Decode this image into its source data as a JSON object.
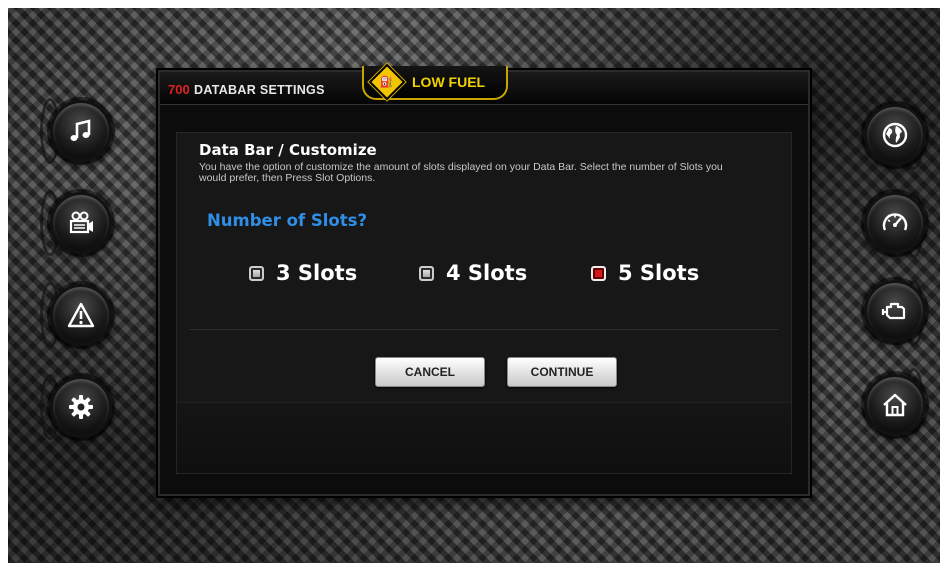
{
  "header": {
    "page_number": "700",
    "title": "DATABAR SETTINGS",
    "alert": {
      "icon": "fuel-pump-icon",
      "text": "LOW FUEL"
    }
  },
  "section": {
    "title": "Data Bar / Customize",
    "description": "You have the option of customize the amount of slots displayed on your Data Bar. Select the number of Slots you would prefer, then Press Slot Options."
  },
  "question": "Number of Slots?",
  "options": [
    {
      "label": "3 Slots",
      "selected": false
    },
    {
      "label": "4 Slots",
      "selected": false
    },
    {
      "label": "5 Slots",
      "selected": true
    }
  ],
  "buttons": {
    "cancel": "CANCEL",
    "continue": "CONTINUE"
  },
  "left_nav": [
    "music-note-icon",
    "video-camera-icon",
    "warning-icon",
    "gear-icon"
  ],
  "right_nav": [
    "globe-icon",
    "speedometer-icon",
    "engine-icon",
    "home-icon"
  ],
  "colors": {
    "accent_blue": "#2f8fe8",
    "alert_yellow": "#f2d200",
    "selected_red": "#d21818",
    "page_number_red": "#d22222"
  }
}
